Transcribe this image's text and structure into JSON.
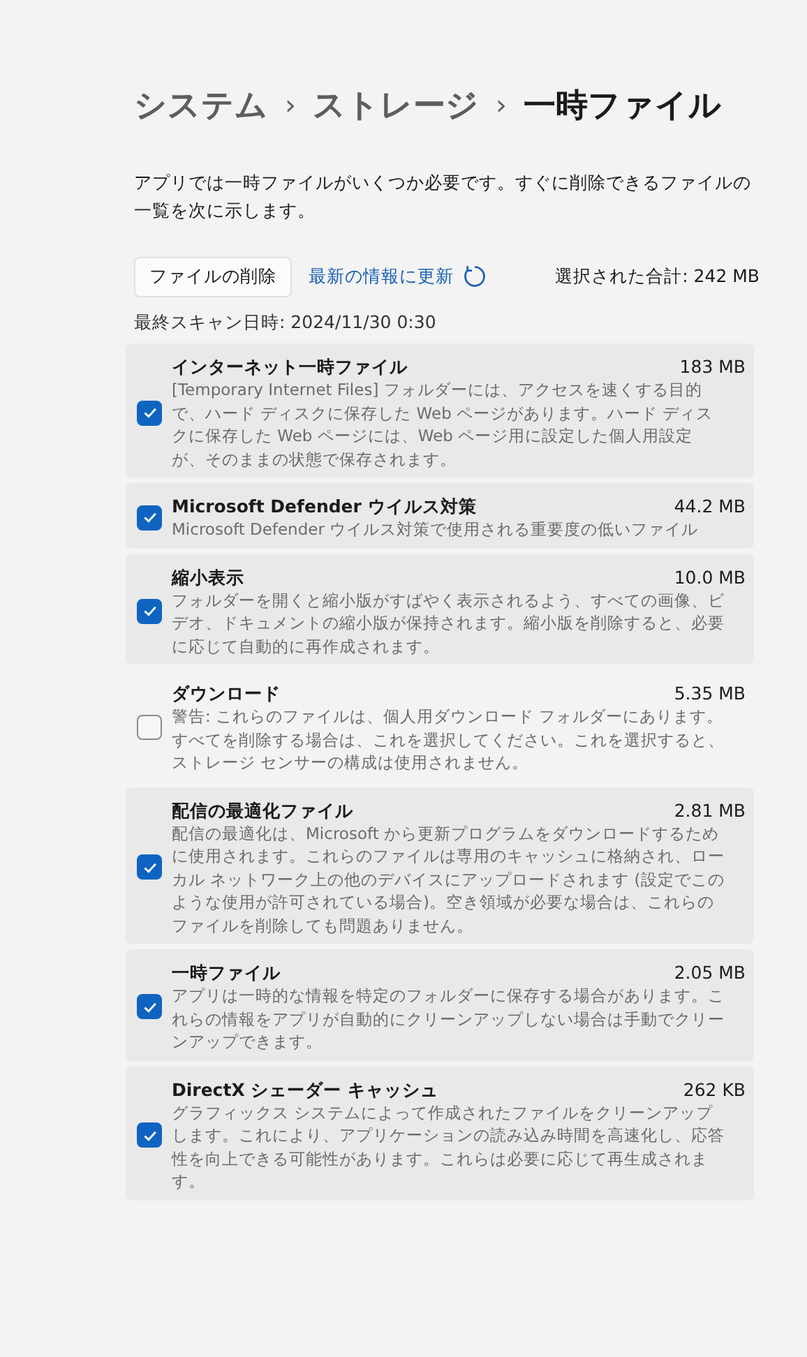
{
  "breadcrumb": [
    {
      "label": "システム",
      "current": false
    },
    {
      "label": "›",
      "kind": "separator"
    },
    {
      "label": "ストレージ",
      "current": false
    },
    {
      "label": "›",
      "kind": "separator"
    },
    {
      "label": "一時ファイル",
      "current": true
    }
  ],
  "intro": "アプリでは一時ファイルがいくつか必要です。すぐに削除できるファイルの一覧を次に示します。",
  "toolbar": {
    "delete_button": "ファイルの削除",
    "refresh_link": "最新の情報に更新",
    "total": "選択された合計: 242 MB"
  },
  "last_scan": "最終スキャン日時: 2024/11/30 0:30",
  "items": [
    {
      "title": "インターネット一時ファイル",
      "size": "183 MB",
      "description": "[Temporary Internet Files] フォルダーには、アクセスを速くする目的で、ハード ディスクに保存した Web ページがあります。ハード ディスクに保存した Web ページには、Web ページ用に設定した個人用設定が、そのままの状態で保存されます。",
      "checked": true
    },
    {
      "title": "Microsoft Defender ウイルス対策",
      "size": "44.2 MB",
      "description": "Microsoft Defender ウイルス対策で使用される重要度の低いファイル",
      "checked": true
    },
    {
      "title": "縮小表示",
      "size": "10.0 MB",
      "description": "フォルダーを開くと縮小版がすばやく表示されるよう、すべての画像、ビデオ、ドキュメントの縮小版が保持されます。縮小版を削除すると、必要に応じて自動的に再作成されます。",
      "checked": true
    },
    {
      "title": "ダウンロード",
      "size": "5.35 MB",
      "description": "警告: これらのファイルは、個人用ダウンロード フォルダーにあります。すべてを削除する場合は、これを選択してください。これを選択すると、ストレージ センサーの構成は使用されません。",
      "checked": false
    },
    {
      "title": "配信の最適化ファイル",
      "size": "2.81 MB",
      "description": "配信の最適化は、Microsoft から更新プログラムをダウンロードするために使用されます。これらのファイルは専用のキャッシュに格納され、ローカル ネットワーク上の他のデバイスにアップロードされます (設定でこのような使用が許可されている場合)。空き領域が必要な場合は、これらのファイルを削除しても問題ありません。",
      "checked": true
    },
    {
      "title": "一時ファイル",
      "size": "2.05 MB",
      "description": "アプリは一時的な情報を特定のフォルダーに保存する場合があります。これらの情報をアプリが自動的にクリーンアップしない場合は手動でクリーンアップできます。",
      "checked": true
    },
    {
      "title": "DirectX シェーダー キャッシュ",
      "size": "262 KB",
      "description": "グラフィックス システムによって作成されたファイルをクリーンアップします。これにより、アプリケーションの読み込み時間を高速化し、応答性を向上できる可能性があります。これらは必要に応じて再生成されます。",
      "checked": true
    }
  ]
}
